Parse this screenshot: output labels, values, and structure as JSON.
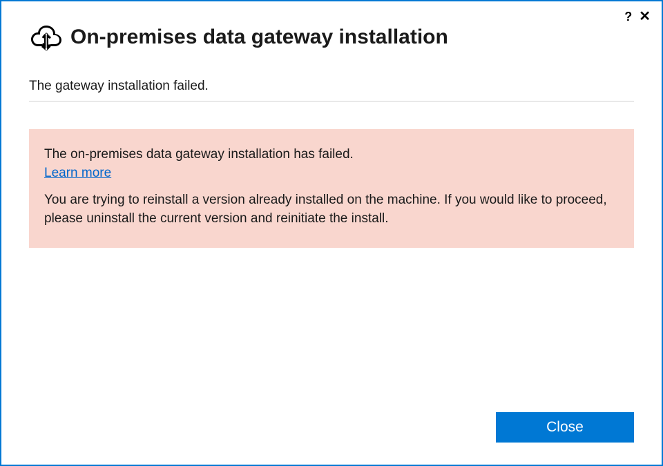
{
  "title": "On-premises data gateway installation",
  "status": "The gateway installation failed.",
  "error": {
    "heading": "The on-premises data gateway installation has failed.",
    "learn_more": "Learn more",
    "body": "You are trying to reinstall a version already installed on the machine. If you would like to proceed, please uninstall the current version and reinitiate the install."
  },
  "buttons": {
    "close": "Close"
  },
  "titlebar": {
    "help": "?",
    "close": "✕"
  }
}
